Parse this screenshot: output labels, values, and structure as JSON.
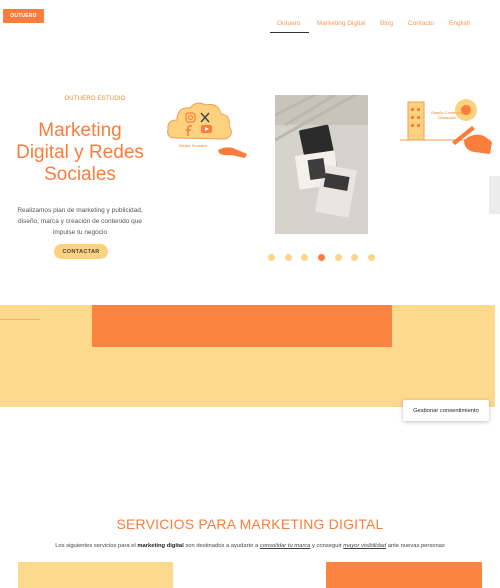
{
  "header": {
    "logo_text": "OUTUERO",
    "nav": [
      {
        "label": "Outuero",
        "active": true
      },
      {
        "label": "Marketing Digital",
        "active": false
      },
      {
        "label": "Blog",
        "active": false
      },
      {
        "label": "Contacto",
        "active": false
      },
      {
        "label": "English",
        "active": false
      }
    ]
  },
  "hero": {
    "eyebrow": "OUTUERO ESTUDIO",
    "title_line1": "Marketing",
    "title_line2": "Digital y Redes",
    "title_line3": "Sociales",
    "desc_line1": "Realizamos plan de marketing y publicidad,",
    "desc_line2": "diseño, marca y creación de contenido que",
    "desc_line3": "impulse tu negocio",
    "cta_label": "CONTACTAR",
    "illustration_left_caption": "Redes Sociales",
    "illustration_right_caption": "Diseño Creativo y Desarrollo"
  },
  "carousel": {
    "slide_count": 7,
    "active_index": 3
  },
  "consent": {
    "label": "Gestionar consentimiento"
  },
  "services": {
    "title": "SERVICIOS PARA MARKETING DIGITAL",
    "sub_part1": "Los siguientes servicios para el ",
    "sub_bold": "marketing digital",
    "sub_part2": " son destinados a ayudarte a ",
    "sub_link1": "consolidar tu marca",
    "sub_part3": " y conseguir ",
    "sub_link2": "mayor visibilidad",
    "sub_part4": " ante nuevas personas"
  },
  "colors": {
    "orange": "#fb7d3b",
    "yellow": "#fdd98e",
    "text": "#333333"
  },
  "icons": [
    "instagram-icon",
    "x-icon",
    "facebook-icon",
    "youtube-icon",
    "cloud-icon",
    "hand-icon",
    "pencil-icon",
    "building-icon"
  ]
}
